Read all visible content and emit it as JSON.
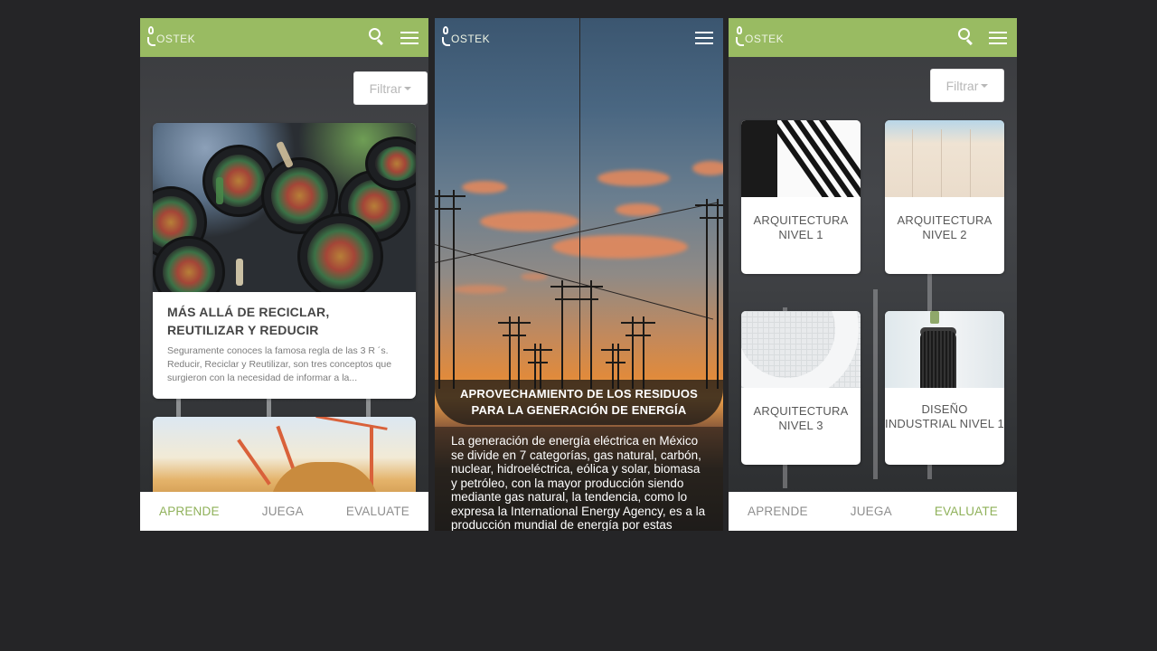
{
  "brand": {
    "logo_text": "OSTEK",
    "accent_color": "#99bb62",
    "active_nav_color": "#8fb15a"
  },
  "screen1": {
    "header": {
      "icons": [
        "logo-icon",
        "search-icon",
        "menu-icon"
      ]
    },
    "filter": {
      "label": "Filtrar"
    },
    "cards": [
      {
        "title": "MÁS ALLÁ DE RECICLAR, REUTILIZAR Y REDUCIR",
        "excerpt": "Seguramente conoces la famosa regla de las 3 R ´s. Reducir, Reciclar y Reutilizar, son tres conceptos que surgieron con la necesidad de informar a la..."
      }
    ],
    "nav": {
      "items": [
        "APRENDE",
        "JUEGA",
        "EVALUATE"
      ],
      "active": "APRENDE"
    }
  },
  "screen2": {
    "header": {
      "icons": [
        "logo-icon",
        "menu-icon"
      ]
    },
    "article": {
      "title": "APROVECHAMIENTO DE LOS RESIDUOS PARA LA GENERACIÓN DE ENERGÍA",
      "body": "La generación de energía eléctrica en México se divide en 7 categorías, gas natural, carbón, nuclear, hidroeléctrica, eólica y solar, biomasa y petróleo, con la mayor producción siendo mediante gas natural, la tendencia, como lo expresa la International Energy Agency, es a la producción mundial de energía por estas"
    }
  },
  "screen3": {
    "header": {
      "icons": [
        "logo-icon",
        "search-icon",
        "menu-icon"
      ]
    },
    "filter": {
      "label": "Filtrar"
    },
    "courses": [
      {
        "label": "ARQUITECTURA NIVEL 1"
      },
      {
        "label": "ARQUITECTURA NIVEL 2"
      },
      {
        "label": "ARQUITECTURA NIVEL 3"
      },
      {
        "label": "DISEÑO INDUSTRIAL NIVEL 1"
      }
    ],
    "nav": {
      "items": [
        "APRENDE",
        "JUEGA",
        "EVALUATE"
      ],
      "active": "EVALUATE"
    }
  }
}
